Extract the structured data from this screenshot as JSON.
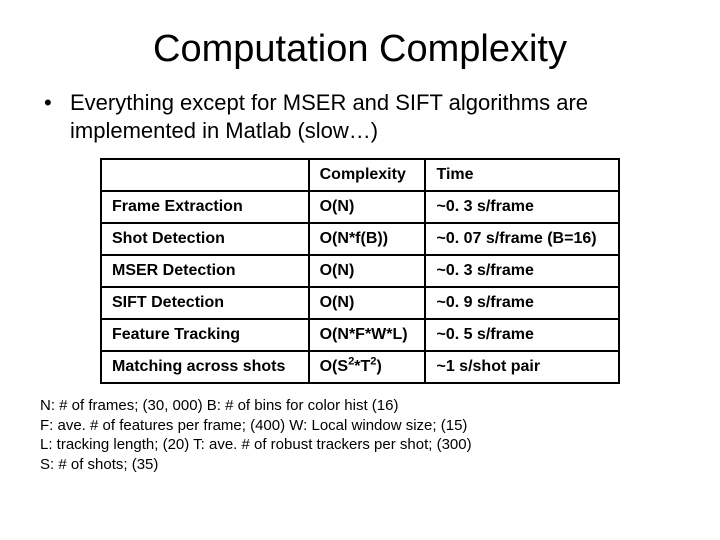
{
  "title": "Computation Complexity",
  "bullet": "Everything except for MSER and SIFT algorithms are implemented in Matlab (slow…)",
  "table": {
    "headers": {
      "c0": "",
      "c1": "Complexity",
      "c2": "Time"
    },
    "rows": [
      {
        "label": "Frame Extraction",
        "complexity": "O(N)",
        "time": "~0. 3 s/frame"
      },
      {
        "label": "Shot Detection",
        "complexity": "O(N*f(B))",
        "time": "~0. 07 s/frame (B=16)"
      },
      {
        "label": "MSER Detection",
        "complexity": "O(N)",
        "time": "~0. 3 s/frame"
      },
      {
        "label": "SIFT Detection",
        "complexity": "O(N)",
        "time": "~0. 9 s/frame"
      },
      {
        "label": "Feature Tracking",
        "complexity": "O(N*F*W*L)",
        "time": "~0. 5 s/frame"
      },
      {
        "label": "Matching across shots",
        "complexity_html": "O(S<sup>2</sup>*T<sup>2</sup>)",
        "time": "~1 s/shot pair"
      }
    ]
  },
  "legend": [
    "N: # of frames; (30, 000) B: # of bins for color hist (16)",
    "F: ave. # of features per frame; (400) W: Local window size; (15)",
    "L: tracking length; (20) T: ave. # of robust trackers per shot; (300)",
    "S: # of shots; (35)"
  ]
}
